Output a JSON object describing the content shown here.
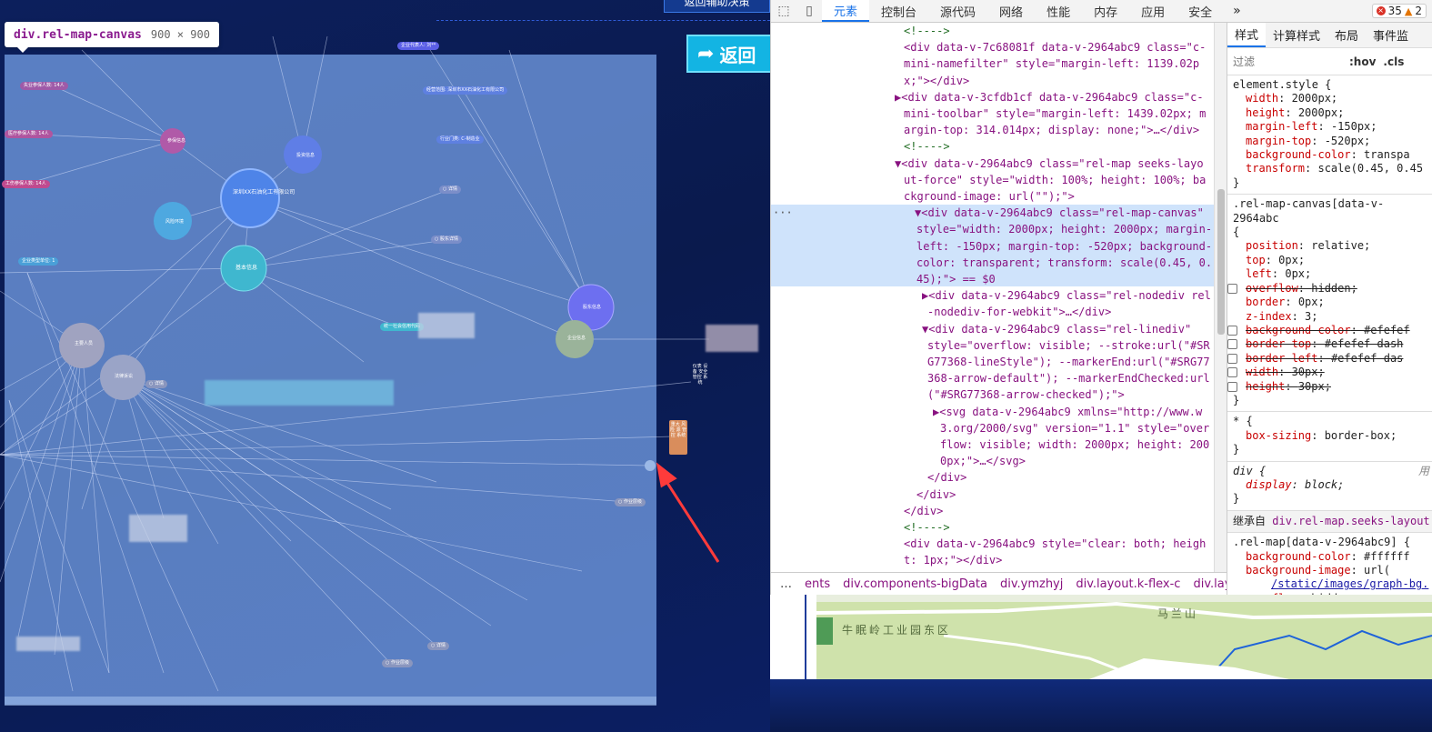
{
  "app": {
    "top_button": "返回辅助决策",
    "back_button": "返回",
    "tooltip_name": "div.rel-map-canvas",
    "tooltip_size": "900 × 900",
    "nodes": [
      {
        "label": "深圳XX石油化工有限公司"
      },
      {
        "label": "基本信息"
      },
      {
        "label": "参保信息"
      },
      {
        "label": "投资信息"
      },
      {
        "label": "风险环境"
      },
      {
        "label": "股东信息"
      },
      {
        "label": "主要人员"
      },
      {
        "label": "法律诉讼"
      },
      {
        "label": "企业信息"
      }
    ],
    "small_labels": [
      "企业代表人: 刘**",
      "失业参保人数: 14人",
      "经营范围: 深圳市XX石油化工有限公司",
      "医疗参保人数: 14人",
      "行业门类: C-制造业",
      "工伤参保人数: 14人",
      "○ 详情",
      "○ 股东详情",
      "企业类型单位: 1",
      "统一社会信用代码",
      "○ 详情",
      "○ 作业层级",
      "○ 详情",
      "○ 作业层级"
    ],
    "side_cards": [
      {
        "text": "仪表 设备 安全 管控 系统"
      },
      {
        "text": "重大 风险 源 管控 系统"
      }
    ],
    "map_labels": [
      "牛眠岭工业园东区",
      "马兰山"
    ]
  },
  "devtools": {
    "tabs": [
      "元素",
      "控制台",
      "源代码",
      "网络",
      "性能",
      "内存",
      "应用",
      "安全"
    ],
    "more": "»",
    "error_count": "35",
    "warn_count": "2",
    "dom_lines": [
      {
        "kind": "comment",
        "text": "<!---->"
      },
      {
        "kind": "tag",
        "text": "<div data-v-7c68081f data-v-2964abc9 class=\"c-"
      },
      {
        "kind": "tag",
        "text": "mini-namefilter\" style=\"margin-left: 1139.02p"
      },
      {
        "kind": "tag",
        "text": "x;\"></div>"
      },
      {
        "kind": "tag",
        "text": "▶<div data-v-3cfdb1cf data-v-2964abc9 class=\"c-"
      },
      {
        "kind": "tag",
        "text": "mini-toolbar\" style=\"margin-left: 1439.02px; m"
      },
      {
        "kind": "tag",
        "text": "argin-top: 314.014px; display: none;\">…</div>"
      },
      {
        "kind": "comment",
        "text": "<!---->"
      },
      {
        "kind": "tag",
        "text": "▼<div data-v-2964abc9 class=\"rel-map seeks-layo"
      },
      {
        "kind": "tag",
        "text": "ut-force\" style=\"width: 100%; height: 100%; ba"
      },
      {
        "kind": "tag",
        "text": "ckground-image: url(\"\");\">"
      },
      {
        "kind": "tag",
        "text": "▼<div data-v-2964abc9 class=\"rel-map-canvas\""
      },
      {
        "kind": "tag",
        "text": "style=\"width: 2000px; height: 2000px; margin-"
      },
      {
        "kind": "tag",
        "text": "left: -150px; margin-top: -520px; background-"
      },
      {
        "kind": "tag",
        "text": "color: transparent; transform: scale(0.45, 0."
      },
      {
        "kind": "tag",
        "text": "45);\"> == $0"
      },
      {
        "kind": "tag",
        "text": "▶<div data-v-2964abc9 class=\"rel-nodediv rel"
      },
      {
        "kind": "tag",
        "text": "-nodediv-for-webkit\">…</div>"
      },
      {
        "kind": "tag",
        "text": "▼<div data-v-2964abc9 class=\"rel-linediv\""
      },
      {
        "kind": "tag",
        "text": "style=\"overflow: visible; --stroke:url(\"#SR"
      },
      {
        "kind": "tag",
        "text": "G77368-lineStyle\"); --markerEnd:url(\"#SRG77"
      },
      {
        "kind": "tag",
        "text": "368-arrow-default\"); --markerEndChecked:url"
      },
      {
        "kind": "tag",
        "text": "(\"#SRG77368-arrow-checked\");\">"
      },
      {
        "kind": "tag",
        "text": "▶<svg data-v-2964abc9 xmlns=\"http://www.w"
      },
      {
        "kind": "tag",
        "text": "3.org/2000/svg\" version=\"1.1\" style=\"over"
      },
      {
        "kind": "tag",
        "text": "flow: visible; width: 2000px; height: 200"
      },
      {
        "kind": "tag",
        "text": "0px;\">…</svg>"
      },
      {
        "kind": "tag",
        "text": "</div>"
      },
      {
        "kind": "tag",
        "text": "</div>"
      },
      {
        "kind": "tag",
        "text": "</div>"
      },
      {
        "kind": "comment",
        "text": "<!---->"
      },
      {
        "kind": "tag",
        "text": "<div data-v-2964abc9 style=\"clear: both; heigh"
      },
      {
        "kind": "tag",
        "text": "t: 1px;\"></div>"
      }
    ],
    "breadcrumbs": [
      "…",
      "ents",
      "div.components-bigData",
      "div.ymzhyj",
      "div.layout.k-flex-c",
      "div.layer",
      "…"
    ],
    "styles": {
      "tabs": [
        "样式",
        "计算样式",
        "布局",
        "事件监"
      ],
      "filter_placeholder": "过滤",
      "hov": ":hov",
      "cls": ".cls",
      "element_style_selector": "element.style {",
      "element_style_props": [
        {
          "name": "width",
          "value": "2000px;"
        },
        {
          "name": "height",
          "value": "2000px;"
        },
        {
          "name": "margin-left",
          "value": "-150px;"
        },
        {
          "name": "margin-top",
          "value": "-520px;"
        },
        {
          "name": "background-color",
          "value": "transpa"
        },
        {
          "name": "transform",
          "value": "scale(0.45, 0.45"
        }
      ],
      "canvas_selector": ".rel-map-canvas[data-v-2964abc",
      "canvas_props": [
        {
          "name": "position",
          "value": "relative;",
          "strike": false
        },
        {
          "name": "top",
          "value": "0px;",
          "strike": false
        },
        {
          "name": "left",
          "value": "0px;",
          "strike": false
        },
        {
          "name": "overflow",
          "value": "hidden;",
          "strike": true
        },
        {
          "name": "border",
          "value": "0px;",
          "strike": false
        },
        {
          "name": "z-index",
          "value": "3;",
          "strike": false
        },
        {
          "name": "background-color",
          "value": "#efefef",
          "strike": true
        },
        {
          "name": "border-top",
          "value": "#efefef dash",
          "strike": true
        },
        {
          "name": "border-left",
          "value": "#efefef das",
          "strike": true
        },
        {
          "name": "width",
          "value": "30px;",
          "strike": true
        },
        {
          "name": "height",
          "value": "30px;",
          "strike": true
        }
      ],
      "star_selector": "* {",
      "star_prop": {
        "name": "box-sizing",
        "value": "border-box;"
      },
      "div_selector": "div {",
      "div_origin": "用",
      "div_prop": {
        "name": "display",
        "value": "block;"
      },
      "inherit_label": "继承自",
      "inherit_from": "div.rel-map.seeks-layout",
      "relmap_selector": ".rel-map[data-v-2964abc9] {",
      "relmap_props": [
        {
          "name": "background-color",
          "value": "#ffffff"
        },
        {
          "name": "background-image",
          "value": "url("
        },
        {
          "name": "",
          "value": "/static/images/graph-bg."
        },
        {
          "name": "overflow",
          "value": "hidden;"
        }
      ]
    }
  }
}
